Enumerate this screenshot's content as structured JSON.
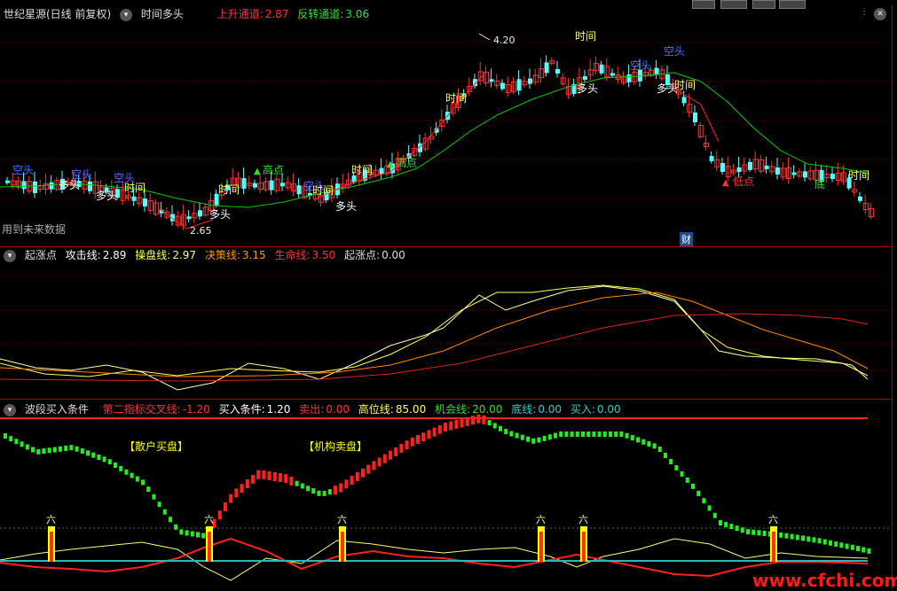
{
  "main_panel": {
    "title": "世纪星源(日线 前复权)",
    "indicator_name": "时间多头",
    "up_channel_label": "上升通道:",
    "up_channel_value": "2.87",
    "rev_channel_label": "反转通道:",
    "rev_channel_value": "3.06",
    "future_data_note": "用到未来数据",
    "high_price_label": "4.20",
    "low_price_label": "2.65",
    "fin_badge": "财",
    "annotations": {
      "kong_tou": "空头",
      "duo_tou": "多头",
      "shi_jian": "时间",
      "gao_dian": "高点",
      "di_dian": "低点",
      "di": "底"
    }
  },
  "indicator1": {
    "name": "起涨点",
    "attack_label": "攻击线:",
    "attack_value": "2.89",
    "operate_label": "操盘线:",
    "operate_value": "2.97",
    "decision_label": "决策线:",
    "decision_value": "3.15",
    "life_label": "生命线:",
    "life_value": "3.50",
    "start_label": "起涨点:",
    "start_value": "0.00"
  },
  "indicator2": {
    "name": "波段买入条件",
    "cross_label": "第二指标交叉线:",
    "cross_value": "-1.20",
    "buy_cond_label": "买入条件:",
    "buy_cond_value": "1.20",
    "sell_label": "卖出:",
    "sell_value": "0.00",
    "high_label": "高位线:",
    "high_value": "85.00",
    "chance_label": "机会线:",
    "chance_value": "20.00",
    "bottom_label": "底线:",
    "bottom_value": "0.00",
    "buy_label": "买入:",
    "buy_value": "0.00",
    "retail_label": "【散户买盘】",
    "inst_label": "【机构卖盘】",
    "six_label": "六"
  },
  "watermark": "www.cfchi.com",
  "colors": {
    "up": "#ff3333",
    "down": "#54ffff",
    "ma_green": "#00cc00",
    "yellow": "#ffff00",
    "orange": "#ff8800",
    "red": "#ff2020",
    "teal": "#2ab7b7"
  }
}
